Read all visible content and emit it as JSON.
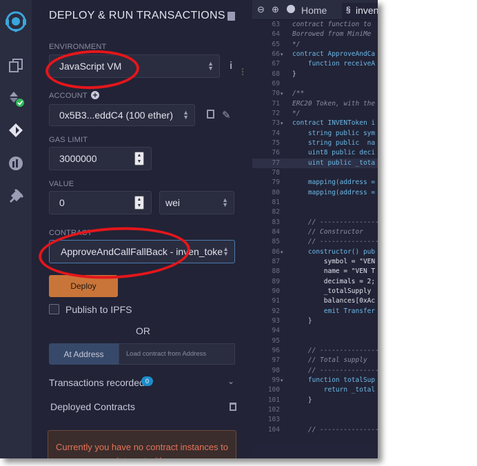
{
  "panel": {
    "title": "DEPLOY & RUN TRANSACTIONS",
    "environment_label": "ENVIRONMENT",
    "environment_value": "JavaScript VM",
    "account_label": "ACCOUNT",
    "account_value": "0x5B3...eddC4 (100 ether)",
    "gas_limit_label": "GAS LIMIT",
    "gas_limit_value": "3000000",
    "value_label": "VALUE",
    "value_amount": "0",
    "value_unit": "wei",
    "contract_label": "CONTRACT",
    "contract_value": "ApproveAndCallFallBack - inven_token",
    "deploy_label": "Deploy",
    "publish_label": "Publish to IPFS",
    "or_label": "OR",
    "at_address_label": "At Address",
    "load_address_placeholder": "Load contract from Address",
    "transactions_label": "Transactions recorded",
    "transactions_count": "0",
    "deployed_label": "Deployed Contracts",
    "notice": "Currently you have no contract instances to interact with."
  },
  "editor": {
    "tabs": [
      "Home",
      "inven"
    ],
    "lines": [
      {
        "n": "63",
        "t": "contract function to"
      },
      {
        "n": "64",
        "t": "Borrowed from MiniMe"
      },
      {
        "n": "65",
        "t": "*/"
      },
      {
        "n": "66",
        "t": "contract ApproveAndCa"
      },
      {
        "n": "67",
        "t": "    function receiveA"
      },
      {
        "n": "68",
        "t": "}"
      },
      {
        "n": "69",
        "t": ""
      },
      {
        "n": "70",
        "t": "/**"
      },
      {
        "n": "71",
        "t": "ERC20 Token, with the"
      },
      {
        "n": "72",
        "t": "*/"
      },
      {
        "n": "73",
        "t": "contract INVENToken i"
      },
      {
        "n": "74",
        "t": "    string public sym"
      },
      {
        "n": "75",
        "t": "    string public  na"
      },
      {
        "n": "76",
        "t": "    uint8 public deci"
      },
      {
        "n": "77",
        "t": "    uint public _tota"
      },
      {
        "n": "78",
        "t": ""
      },
      {
        "n": "79",
        "t": "    mapping(address ="
      },
      {
        "n": "80",
        "t": "    mapping(address ="
      },
      {
        "n": "81",
        "t": ""
      },
      {
        "n": "82",
        "t": ""
      },
      {
        "n": "83",
        "t": "    // ---------------"
      },
      {
        "n": "84",
        "t": "    // Constructor"
      },
      {
        "n": "85",
        "t": "    // ---------------"
      },
      {
        "n": "86",
        "t": "    constructor() pub"
      },
      {
        "n": "87",
        "t": "        symbol = \"VEN"
      },
      {
        "n": "88",
        "t": "        name = \"VEN T"
      },
      {
        "n": "89",
        "t": "        decimals = 2;"
      },
      {
        "n": "90",
        "t": "        _totalSupply"
      },
      {
        "n": "91",
        "t": "        balances[0xAc"
      },
      {
        "n": "92",
        "t": "        emit Transfer"
      },
      {
        "n": "93",
        "t": "    }"
      },
      {
        "n": "94",
        "t": ""
      },
      {
        "n": "95",
        "t": ""
      },
      {
        "n": "96",
        "t": "    // ---------------"
      },
      {
        "n": "97",
        "t": "    // Total supply"
      },
      {
        "n": "98",
        "t": "    // ---------------"
      },
      {
        "n": "99",
        "t": "    function totalSup"
      },
      {
        "n": "100",
        "t": "        return _total"
      },
      {
        "n": "101",
        "t": "    }"
      },
      {
        "n": "102",
        "t": ""
      },
      {
        "n": "103",
        "t": ""
      },
      {
        "n": "104",
        "t": "    // ---------------"
      }
    ]
  },
  "colors": {
    "accent": "#c97539",
    "annotation": "#e4161b",
    "badge": "#1d8cca",
    "notice_text": "#e57458"
  }
}
